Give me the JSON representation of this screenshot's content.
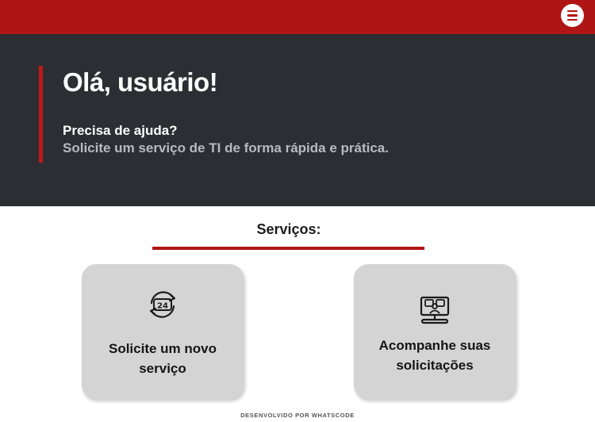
{
  "colors": {
    "topbar": "#b01515",
    "hero_bg": "#2d2e33",
    "accent": "#c01818",
    "card_bg": "#d4d4d4"
  },
  "header": {
    "menu_icon": "hamburger-menu-icon"
  },
  "hero": {
    "title": "Olá, usuário!",
    "question": "Precisa de ajuda?",
    "subtitle": "Solicite um serviço de TI  de forma rápida e prática."
  },
  "services": {
    "title": "Serviços:",
    "cards": [
      {
        "icon": "24-hours-icon",
        "line1": "Solicite um novo",
        "line2": "serviço"
      },
      {
        "icon": "support-monitor-icon",
        "line1": "Acompanhe suas",
        "line2": "solicitações"
      }
    ]
  },
  "footer": {
    "text": "DESENVOLVIDO POR WHATSCODE"
  }
}
